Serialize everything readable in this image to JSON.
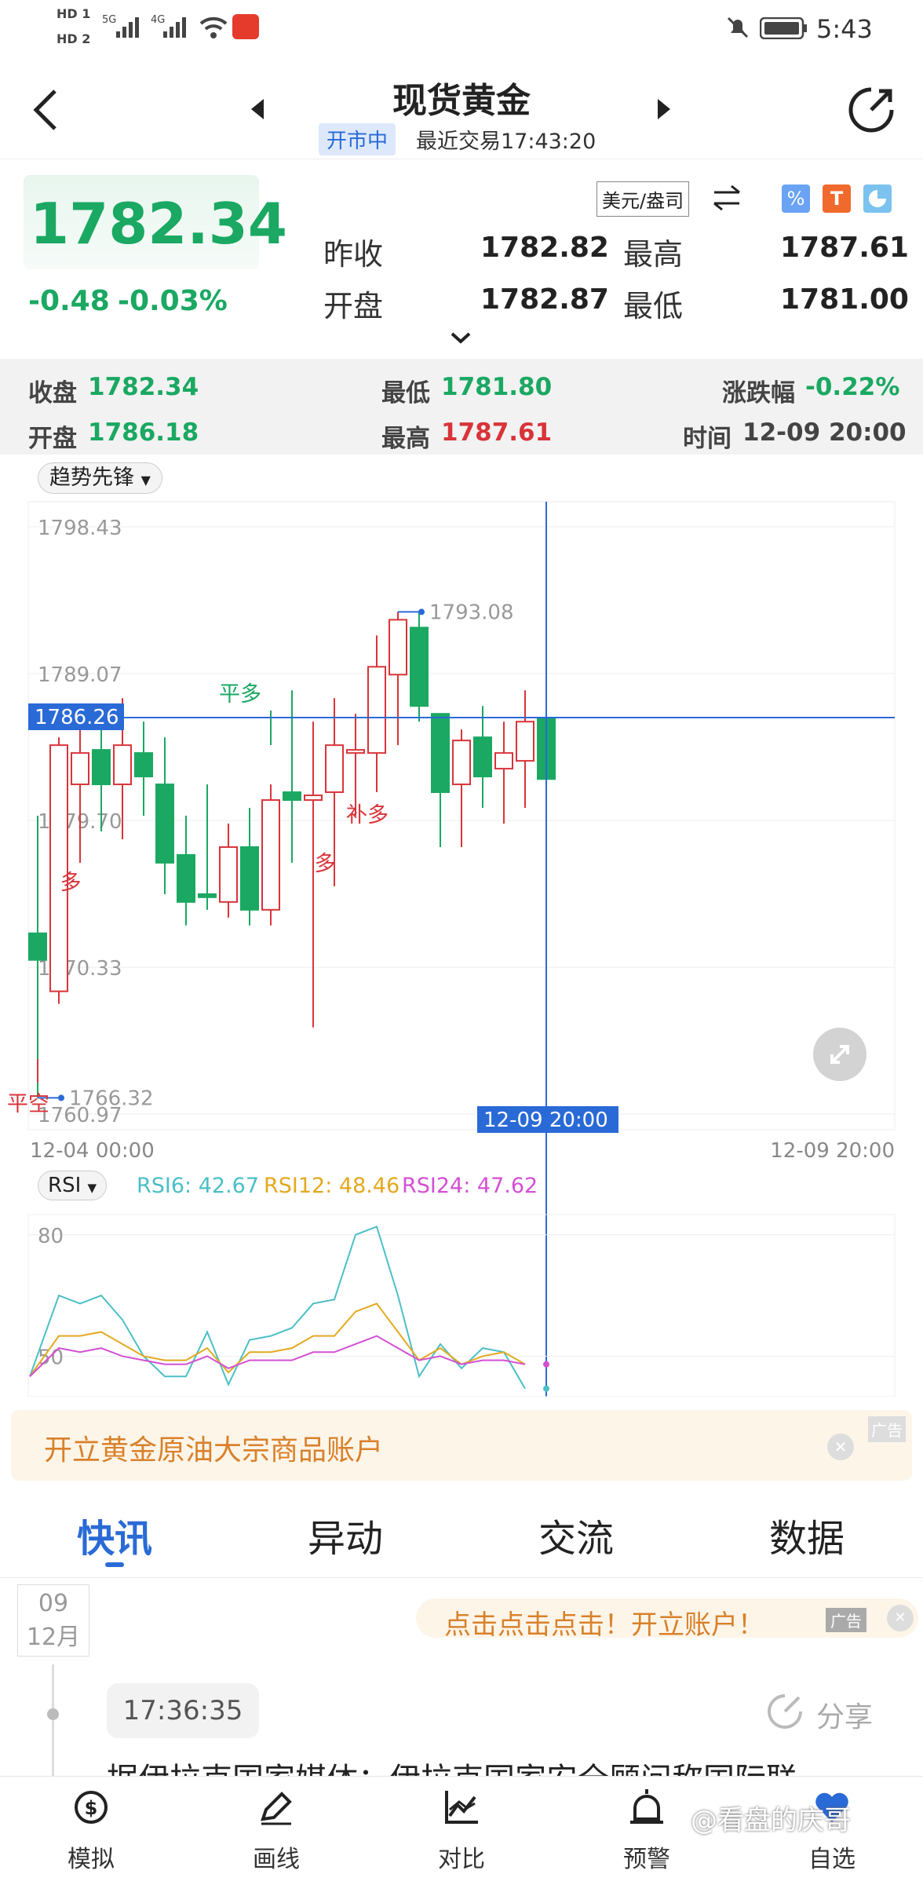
{
  "status_bar": {
    "time": "5:43",
    "net1": "HD 1",
    "net2": "HD 2",
    "sig1": "5G",
    "sig2": "4G"
  },
  "header": {
    "title": "现货黄金",
    "market_status": "开市中",
    "last_trade": "最近交易17:43:20"
  },
  "quote": {
    "price": "1782.34",
    "change": "-0.48",
    "change_pct": "-0.03%",
    "unit": "美元/盎司",
    "prev_close_label": "昨收",
    "prev_close": "1782.82",
    "high_label": "最高",
    "high": "1787.61",
    "open_label": "开盘",
    "open": "1782.87",
    "low_label": "最低",
    "low": "1781.00"
  },
  "candle_summary": {
    "close_label": "收盘",
    "close": "1782.34",
    "low_label": "最低",
    "low": "1781.80",
    "change_label": "涨跌幅",
    "change": "-0.22%",
    "open_label": "开盘",
    "open": "1786.18",
    "high_label": "最高",
    "high": "1787.61",
    "time_label": "时间",
    "time": "12-09 20:00"
  },
  "chart": {
    "indicator_select": "趋势先锋",
    "y_ticks": [
      "1798.43",
      "1789.07",
      "1779.70",
      "1770.33",
      "1760.97"
    ],
    "crosshair_price": "1786.26",
    "crosshair_time": "12-09 20:00",
    "x_start": "12-04 00:00",
    "x_end": "12-09 20:00",
    "max_label": "1793.08",
    "min_label": "1766.32",
    "signals": {
      "ping_duo": "平多",
      "duo1": "多",
      "duo2": "多",
      "bu_duo": "补多",
      "kong": "平空"
    }
  },
  "chart_data": {
    "type": "candlestick",
    "ylim": [
      1760.97,
      1798.43
    ],
    "candles": [
      {
        "o": 1772.5,
        "h": 1780.0,
        "l": 1762.0,
        "c": 1770.8
      },
      {
        "o": 1768.8,
        "h": 1785.0,
        "l": 1768.0,
        "c": 1784.5
      },
      {
        "o": 1782.0,
        "h": 1787.0,
        "l": 1778.0,
        "c": 1784.0
      },
      {
        "o": 1784.2,
        "h": 1786.0,
        "l": 1779.0,
        "c": 1782.0
      },
      {
        "o": 1782.0,
        "h": 1787.5,
        "l": 1778.5,
        "c": 1784.5
      },
      {
        "o": 1784.0,
        "h": 1786.0,
        "l": 1780.0,
        "c": 1782.5
      },
      {
        "o": 1782.0,
        "h": 1785.0,
        "l": 1775.0,
        "c": 1777.0
      },
      {
        "o": 1777.5,
        "h": 1780.0,
        "l": 1773.0,
        "c": 1774.5
      },
      {
        "o": 1775.0,
        "h": 1782.0,
        "l": 1774.0,
        "c": 1774.8
      },
      {
        "o": 1774.5,
        "h": 1779.5,
        "l": 1773.5,
        "c": 1778.0
      },
      {
        "o": 1778.0,
        "h": 1780.5,
        "l": 1773.0,
        "c": 1774.0
      },
      {
        "o": 1774.0,
        "h": 1782.0,
        "l": 1773.0,
        "c": 1781.0
      },
      {
        "o": 1781.5,
        "h": 1788.0,
        "l": 1777.0,
        "c": 1781.0
      },
      {
        "o": 1781.0,
        "h": 1786.0,
        "l": 1766.5,
        "c": 1781.3
      },
      {
        "o": 1781.5,
        "h": 1787.5,
        "l": 1775.5,
        "c": 1784.5
      },
      {
        "o": 1784.0,
        "h": 1786.5,
        "l": 1780.0,
        "c": 1784.2
      },
      {
        "o": 1784.0,
        "h": 1791.5,
        "l": 1782.0,
        "c": 1789.5
      },
      {
        "o": 1789.0,
        "h": 1793.0,
        "l": 1784.5,
        "c": 1792.5
      },
      {
        "o": 1792.0,
        "h": 1793.0,
        "l": 1786.0,
        "c": 1787.0
      },
      {
        "o": 1786.5,
        "h": 1786.5,
        "l": 1778.0,
        "c": 1781.5
      },
      {
        "o": 1782.0,
        "h": 1785.5,
        "l": 1778.0,
        "c": 1784.8
      },
      {
        "o": 1785.0,
        "h": 1787.0,
        "l": 1780.5,
        "c": 1782.5
      },
      {
        "o": 1783.0,
        "h": 1786.0,
        "l": 1779.5,
        "c": 1784.0
      },
      {
        "o": 1783.5,
        "h": 1788.0,
        "l": 1780.5,
        "c": 1786.0
      },
      {
        "o": 1786.18,
        "h": 1787.61,
        "l": 1781.8,
        "c": 1782.34
      }
    ]
  },
  "rsi": {
    "select": "RSI",
    "rsi6_label": "RSI6: 42.67",
    "rsi12_label": "RSI12: 48.46",
    "rsi24_label": "RSI24: 47.62",
    "y_ticks": [
      "80",
      "50"
    ],
    "colors": {
      "rsi6": "#4bbfc6",
      "rsi12": "#e3a91f",
      "rsi24": "#d350d3"
    },
    "rsi6": [
      45,
      65,
      63,
      65,
      59,
      50,
      45,
      45,
      56,
      43,
      54,
      55,
      57,
      63,
      64,
      80,
      82,
      65,
      45,
      53,
      47,
      52,
      51,
      42
    ],
    "rsi12": [
      45,
      55,
      55,
      56,
      53,
      50,
      49,
      49,
      52,
      46,
      51,
      51,
      52,
      55,
      55,
      61,
      63,
      56,
      49,
      52,
      48,
      50,
      51,
      48
    ],
    "rsi24": [
      45,
      52,
      51,
      52,
      50,
      49,
      48,
      48,
      50,
      47,
      49,
      49,
      49,
      51,
      51,
      53,
      55,
      52,
      49,
      50,
      48,
      49,
      49,
      48
    ]
  },
  "ads": {
    "ad1_text": "开立黄金原油大宗商品账户",
    "ad_tag": "广告",
    "ad2_text": "点击点击点击！开立账户！"
  },
  "tabs": [
    "快讯",
    "异动",
    "交流",
    "数据"
  ],
  "news": {
    "day": "09",
    "month": "12月",
    "time": "17:36:35",
    "share": "分享",
    "headline": "据伊拉克国家媒体：伊拉克国家安全顾问称国际联"
  },
  "bottom_nav": [
    "模拟",
    "画线",
    "对比",
    "预警",
    "自选"
  ],
  "watermark": "@看盘的庆哥"
}
